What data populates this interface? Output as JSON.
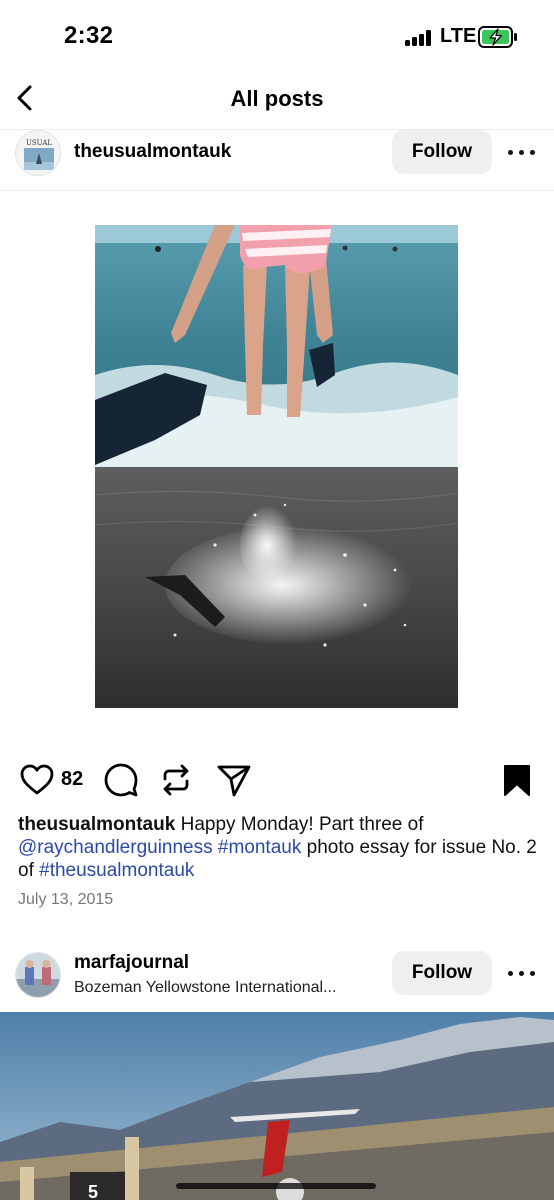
{
  "status_bar": {
    "time": "2:32",
    "carrier": "LTE",
    "battery_color": "#39c759"
  },
  "nav": {
    "title": "All posts",
    "back_icon": "chevron-left-icon"
  },
  "posts": [
    {
      "username": "theusualmontauk",
      "follow_label": "Follow",
      "avatar_text": "USUAL",
      "like_count": "82",
      "caption": {
        "user": "theusualmontauk",
        "text1": " Happy Monday! Part three of ",
        "mention": "@raychandlerguinness",
        "space": " ",
        "hashtag1": "#montauk",
        "text2": " photo essay for issue No. 2 of ",
        "hashtag2": "#theusualmontauk"
      },
      "date": "July 13, 2015",
      "saved": true
    },
    {
      "username": "marfajournal",
      "location": "Bozeman Yellowstone International...",
      "follow_label": "Follow",
      "sign_number": "5"
    }
  ],
  "colors": {
    "link": "#2b4aa5",
    "follow_bg": "#efefef"
  }
}
